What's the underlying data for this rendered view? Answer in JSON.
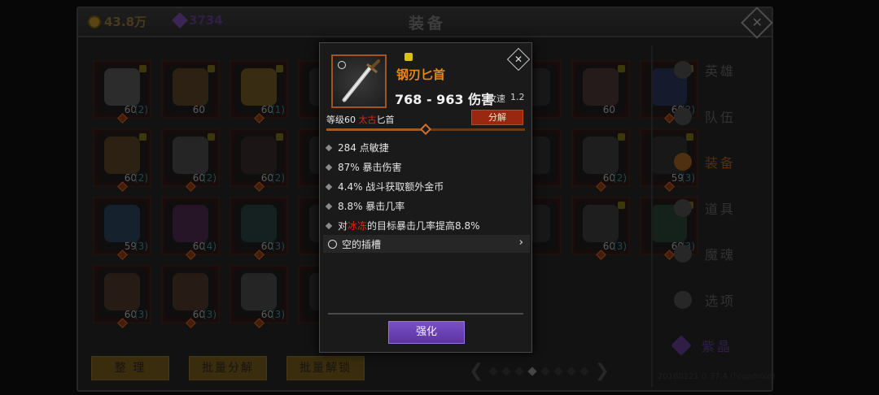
{
  "header": {
    "title": "装备",
    "gold": "43.8万",
    "gems": "3734"
  },
  "grid": {
    "rows": [
      [
        {
          "level": "60",
          "count": "(2)",
          "locked": true,
          "color": "#6a6a6a"
        },
        {
          "level": "60",
          "count": "",
          "locked": true,
          "color": "#6a4a22"
        },
        {
          "level": "60",
          "count": "(1)",
          "locked": true,
          "color": "#8a6a20"
        },
        {
          "level": "",
          "count": "",
          "locked": false,
          "color": "#333"
        },
        {
          "level": "",
          "count": "",
          "locked": false,
          "color": "#333"
        },
        {
          "level": "",
          "count": "",
          "locked": false,
          "color": "#333"
        },
        {
          "level": "",
          "count": "",
          "locked": false,
          "color": "#333"
        },
        {
          "level": "60",
          "count": "",
          "locked": true,
          "color": "#5a3a3a"
        },
        {
          "level": "60",
          "count": "(2)",
          "locked": true,
          "color": "#2a3a6a"
        }
      ],
      [
        {
          "level": "60",
          "count": "(2)",
          "locked": true,
          "color": "#6a4a22"
        },
        {
          "level": "60",
          "count": "(2)",
          "locked": true,
          "color": "#555"
        },
        {
          "level": "60",
          "count": "(2)",
          "locked": true,
          "color": "#3a2a2a"
        },
        {
          "level": "",
          "count": "",
          "locked": false,
          "color": "#333"
        },
        {
          "level": "",
          "count": "",
          "locked": false,
          "color": "#333"
        },
        {
          "level": "",
          "count": "",
          "locked": false,
          "color": "#333"
        },
        {
          "level": "",
          "count": "",
          "locked": false,
          "color": "#333"
        },
        {
          "level": "60",
          "count": "(2)",
          "locked": true,
          "color": "#444"
        },
        {
          "level": "59",
          "count": "(3)",
          "locked": true,
          "color": "#333"
        }
      ],
      [
        {
          "level": "59",
          "count": "(3)",
          "locked": false,
          "color": "#2a4a6a"
        },
        {
          "level": "60",
          "count": "(4)",
          "locked": false,
          "color": "#5a2a5a"
        },
        {
          "level": "60",
          "count": "(3)",
          "locked": false,
          "color": "#2a4a4a"
        },
        {
          "level": "",
          "count": "",
          "locked": false,
          "color": "#333"
        },
        {
          "level": "",
          "count": "",
          "locked": false,
          "color": "#333"
        },
        {
          "level": "",
          "count": "",
          "locked": false,
          "color": "#333"
        },
        {
          "level": "",
          "count": "",
          "locked": false,
          "color": "#333"
        },
        {
          "level": "60",
          "count": "(3)",
          "locked": true,
          "color": "#444"
        },
        {
          "level": "60",
          "count": "(3)",
          "locked": true,
          "color": "#2a4a3a"
        }
      ],
      [
        {
          "level": "60",
          "count": "(3)",
          "locked": false,
          "color": "#5a3a2a"
        },
        {
          "level": "60",
          "count": "(3)",
          "locked": false,
          "color": "#5a3a2a"
        },
        {
          "level": "60",
          "count": "(3)",
          "locked": false,
          "color": "#555"
        },
        {
          "level": "",
          "count": "",
          "locked": false,
          "color": "#333"
        }
      ]
    ]
  },
  "sidebar": {
    "items": [
      {
        "label": "英雄"
      },
      {
        "label": "队伍"
      },
      {
        "label": "装备"
      },
      {
        "label": "道具"
      },
      {
        "label": "魔魂"
      },
      {
        "label": "选项"
      },
      {
        "label": "紫晶"
      }
    ],
    "active_index": 2,
    "watermark": "20180121 0.37.4 (h/android)"
  },
  "bottom": {
    "sort": "整 理",
    "batch_dismantle": "批量分解",
    "batch_unlock": "批量解锁",
    "page_count": 8,
    "current_page": 3
  },
  "popup": {
    "name": "钢刃匕首",
    "damage": "768 - 963 伤害",
    "speed_label": "攻速",
    "speed_value": "1.2",
    "level_prefix": "等级60 ",
    "quality": "太古",
    "item_type": "匕首",
    "dismantle": "分解",
    "progress": 0.5,
    "stats": [
      {
        "text": "284 点敏捷"
      },
      {
        "text": "87% 暴击伤害"
      },
      {
        "text": "4.4% 战斗获取额外金币"
      },
      {
        "text": "8.8% 暴击几率"
      }
    ],
    "special": {
      "pre": "对",
      "highlight": "冰冻",
      "post": "的目标暴击几率提高8.8%"
    },
    "socket": "空的插槽",
    "enhance": "强化"
  }
}
